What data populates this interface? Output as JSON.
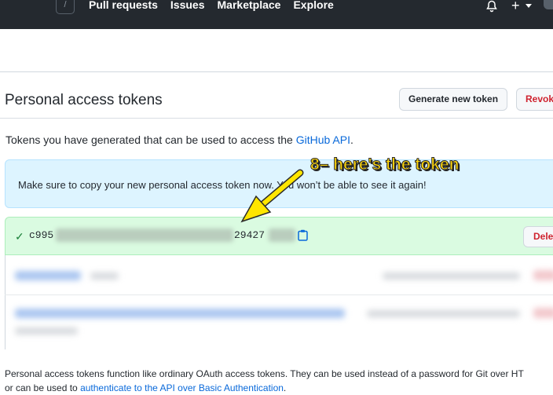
{
  "header": {
    "search_slash": "/",
    "nav": [
      "Pull requests",
      "Issues",
      "Marketplace",
      "Explore"
    ],
    "plus": "+"
  },
  "page": {
    "title": "Personal access tokens",
    "generate_button": "Generate new token",
    "revoke_button": "Revok",
    "description_before": "Tokens you have generated that can be used to access the ",
    "description_link": "GitHub API",
    "description_after": "."
  },
  "flash": {
    "message": "Make sure to copy your new personal access token now. You won’t be able to see it again!"
  },
  "token": {
    "prefix": "c995",
    "suffix": "29427",
    "delete_button": "Dele"
  },
  "annotation": {
    "text": "8– here's the token",
    "color": "#ffd60a"
  },
  "footer": {
    "line1": "Personal access tokens function like ordinary OAuth access tokens. They can be used instead of a password for Git over HT",
    "line2_before": "or can be used to ",
    "line2_link": "authenticate to the API over Basic Authentication",
    "line2_after": "."
  },
  "colors": {
    "header_bg": "#24292f",
    "link": "#0969da",
    "danger": "#cf222e",
    "success": "#1a7f37"
  }
}
